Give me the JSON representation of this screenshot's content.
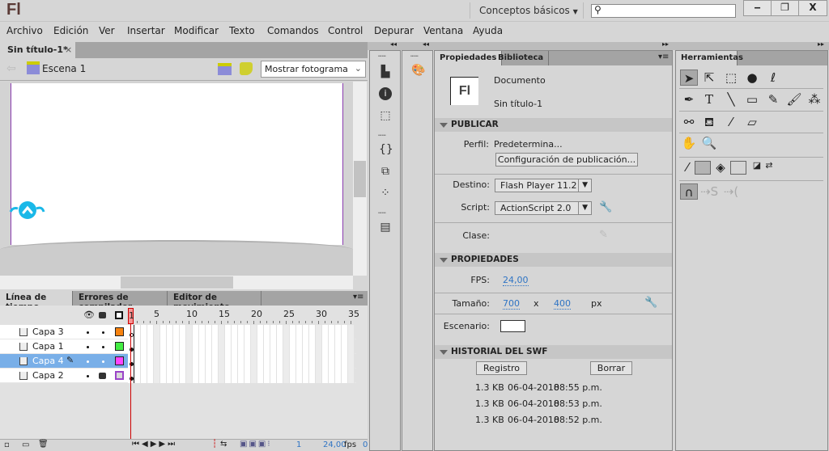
{
  "app": {
    "logo": "Fl",
    "workspace": "Conceptos básicos",
    "search_placeholder": "",
    "window": {
      "minimize": "‒",
      "restore": "❐",
      "close": "X"
    }
  },
  "menu": [
    "Archivo",
    "Edición",
    "Ver",
    "Insertar",
    "Modificar",
    "Texto",
    "Comandos",
    "Control",
    "Depurar",
    "Ventana",
    "Ayuda"
  ],
  "document": {
    "tab": "Sin título-1*",
    "close": "×",
    "scene": "Escena 1",
    "view_select": "Mostrar fotograma"
  },
  "timeline": {
    "tabs": [
      "Línea de tiempo",
      "Errores de compilador",
      "Editor de movimiento"
    ],
    "frame_numbers": [
      "1",
      "5",
      "10",
      "15",
      "20",
      "25",
      "30",
      "35"
    ],
    "layers": [
      {
        "name": "Capa 3",
        "color": "#f7820f",
        "locked": false,
        "selected": false,
        "keyframe": "empty"
      },
      {
        "name": "Capa 1",
        "color": "#44ee44",
        "locked": false,
        "selected": false,
        "keyframe": "filled"
      },
      {
        "name": "Capa 4",
        "color": "#ff44ff",
        "locked": false,
        "selected": true,
        "keyframe": "filled"
      },
      {
        "name": "Capa 2",
        "color": "#d8d8d8",
        "outline": "#9a44c8",
        "locked": true,
        "selected": false,
        "keyframe": "filled"
      }
    ],
    "current_frame": "1",
    "fps": "24,00",
    "fps_unit": "fps",
    "elapsed": "0"
  },
  "properties": {
    "tabs": [
      "Propiedades",
      "Biblioteca"
    ],
    "doc_icon": "Fl",
    "doc_type": "Documento",
    "doc_name": "Sin título-1",
    "publish": {
      "header": "PUBLICAR",
      "profile_label": "Perfil:",
      "profile": "Predetermina...",
      "settings_button": "Configuración de publicación...",
      "target_label": "Destino:",
      "target": "Flash Player 11.2",
      "script_label": "Script:",
      "script": "ActionScript 2.0",
      "class_label": "Clase:"
    },
    "props": {
      "header": "PROPIEDADES",
      "fps_label": "FPS:",
      "fps": "24,00",
      "size_label": "Tamaño:",
      "width": "700",
      "x": "x",
      "height": "400",
      "unit": "px",
      "stage_label": "Escenario:",
      "stage_color": "#ffffff"
    },
    "swf": {
      "header": "HISTORIAL DEL SWF",
      "log_button": "Registro",
      "clear_button": "Borrar",
      "entries": [
        {
          "size": "1.3 KB",
          "date": "06-04-2018",
          "time": "08:55 p.m."
        },
        {
          "size": "1.3 KB",
          "date": "06-04-2018",
          "time": "08:53 p.m."
        },
        {
          "size": "1.3 KB",
          "date": "06-04-2018",
          "time": "08:52 p.m."
        }
      ]
    }
  },
  "tools": {
    "title": "Herramientas"
  }
}
